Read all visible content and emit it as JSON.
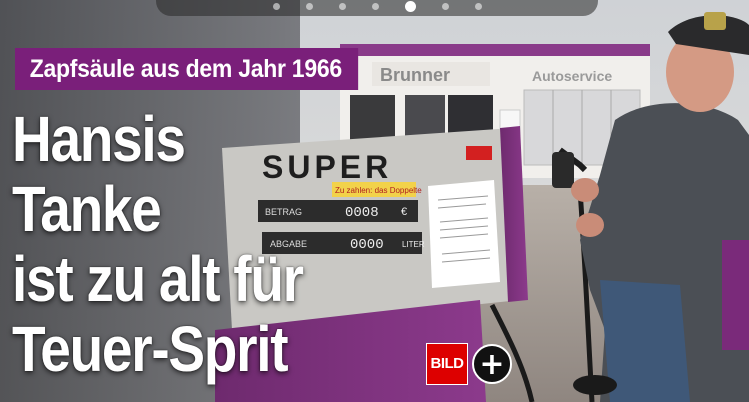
{
  "carousel": {
    "dot_count": 7,
    "active_index": 4
  },
  "kicker": "Zapfsäule aus dem Jahr 1966",
  "headline": [
    "Hansis",
    "Tanke",
    "ist zu alt für",
    "Teuer-Sprit"
  ],
  "photo": {
    "station_sign": "Brunner",
    "service_sign": "Autoservice",
    "pump_label": "SUPER",
    "pump_notice": "Zu zahlen: das Doppelte",
    "pump_betrag_label": "BETRAG",
    "pump_betrag_value": "0008",
    "pump_abgabe_label": "ABGABE",
    "pump_abgabe_value": "0000",
    "pump_liter_label": "LITER",
    "pump_euro_symbol": "€"
  },
  "brand": {
    "logo_text": "BILD",
    "plus_symbol": "+"
  },
  "colors": {
    "kicker_bg": "#7a1f7a",
    "logo_red": "#dd0000"
  }
}
